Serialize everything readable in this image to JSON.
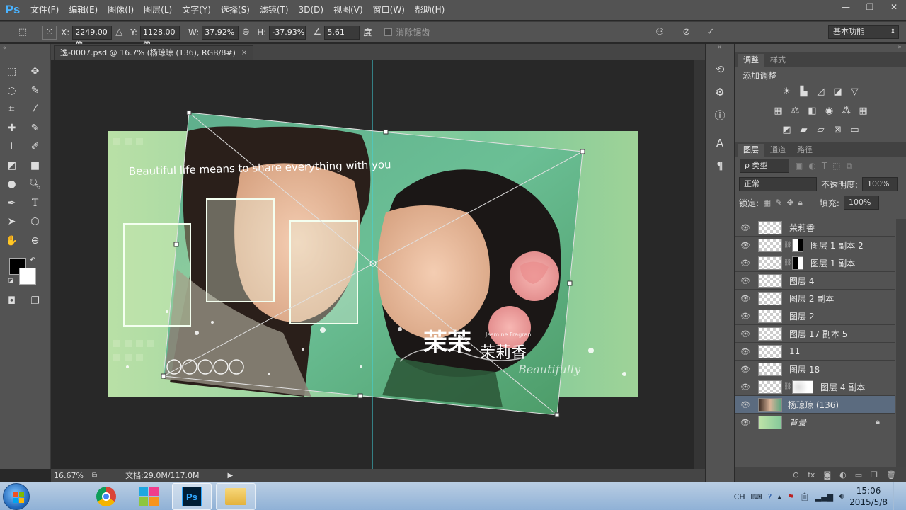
{
  "app": {
    "logo": "Ps",
    "menu": [
      "文件(F)",
      "编辑(E)",
      "图像(I)",
      "图层(L)",
      "文字(Y)",
      "选择(S)",
      "滤镜(T)",
      "3D(D)",
      "视图(V)",
      "窗口(W)",
      "帮助(H)"
    ],
    "window_controls": {
      "minimize": "—",
      "restore": "❐",
      "close": "✕"
    }
  },
  "options": {
    "x_label": "X:",
    "x_value": "2249.00 像",
    "y_label": "Y:",
    "y_value": "1128.00 像",
    "w_label": "W:",
    "w_value": "37.92%",
    "h_label": "H:",
    "h_value": "-37.93%",
    "angle_value": "5.61",
    "angle_unit": "度",
    "antialias_label": "消除锯齿",
    "workspace": "基本功能"
  },
  "document": {
    "tab_title": "逸-0007.psd @ 16.7% (杨琼琼 (136), RGB/8#)",
    "close": "×",
    "photo_text": "Beautiful life means to share everything with you",
    "logo_big": "茉茉",
    "logo_small": "茉莉香",
    "logo_en": "Beautifully",
    "logo_tiny": "Jasmine Fragran"
  },
  "status": {
    "zoom": "16.67%",
    "doc_info": "文档:29.0M/117.0M"
  },
  "panels": {
    "adjust_tab": "调整",
    "style_tab": "样式",
    "adjust_title": "添加调整",
    "layers_tab": "图层",
    "channels_tab": "通道",
    "paths_tab": "路径",
    "filter_kind": "ρ 类型",
    "blend_mode": "正常",
    "opacity_label": "不透明度:",
    "opacity_value": "100%",
    "lock_label": "锁定:",
    "fill_label": "填充:",
    "fill_value": "100%"
  },
  "layers": [
    {
      "name": "茉莉香",
      "mask": "none"
    },
    {
      "name": "图层 1 副本 2",
      "mask": "white-black"
    },
    {
      "name": "图层 1 副本",
      "mask": "black-white"
    },
    {
      "name": "图层 4",
      "mask": "none"
    },
    {
      "name": "图层 2 副本",
      "mask": "none"
    },
    {
      "name": "图层 2",
      "mask": "none"
    },
    {
      "name": "图层 17 副本 5",
      "mask": "none"
    },
    {
      "name": "11",
      "mask": "none"
    },
    {
      "name": "图层 18",
      "mask": "none"
    },
    {
      "name": "图层 4 副本",
      "mask": "soft"
    },
    {
      "name": "杨琼琼 (136)",
      "mask": "photo",
      "selected": true
    },
    {
      "name": "背景",
      "mask": "bg",
      "locked": true
    }
  ],
  "taskbar": {
    "lang": "CH",
    "time": "15:06",
    "date": "2015/5/8",
    "ps_label": "Ps"
  },
  "colors": {
    "accent": "#4ab3ff",
    "panel": "#535353",
    "canvas": "#282828",
    "selected_layer": "#5b6b7f",
    "photo_green": "#7cc89b"
  }
}
